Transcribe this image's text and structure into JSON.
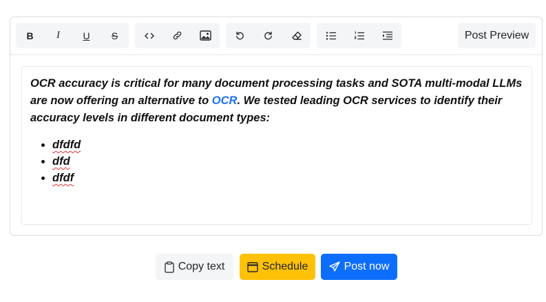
{
  "toolbar": {
    "format": {
      "bold": "B",
      "italic": "I",
      "underline": "U",
      "strike": "S"
    },
    "icons": [
      "code-icon",
      "link-icon",
      "image-icon",
      "undo-icon",
      "redo-icon",
      "eraser-icon",
      "bullet-list-icon",
      "numbered-list-icon",
      "indent-icon"
    ],
    "post_preview_label": "Post Preview"
  },
  "editor": {
    "paragraph_before_link": "OCR accuracy is critical for many document processing tasks and SOTA multi-modal LLMs are now offering an alternative to ",
    "link_text": "OCR",
    "paragraph_after_link": ". We tested leading OCR services to identify their accuracy levels in different document types:",
    "list_items": [
      "dfdfd",
      "dfd",
      "dfdf"
    ],
    "link_color": "#1a73e8",
    "spellcheck_color": "#e03131"
  },
  "actions": {
    "copy_label": "Copy text",
    "schedule_label": "Schedule",
    "post_label": "Post now",
    "schedule_color": "#ffc107",
    "post_color": "#0d6efd"
  }
}
